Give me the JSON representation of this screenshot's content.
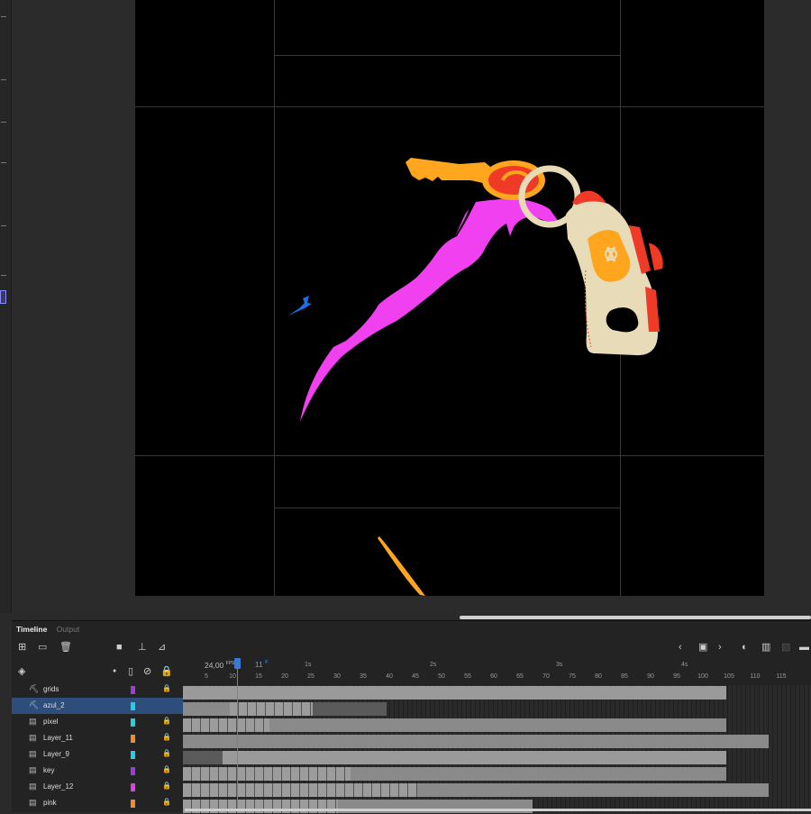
{
  "timeline": {
    "tabs": [
      {
        "label": "Timeline"
      },
      {
        "label": "Output"
      }
    ],
    "fps_value": "24,00",
    "fps_unit": "FPS",
    "current_frame": "11",
    "current_frame_unit": "F",
    "ruler_ticks": [
      "5",
      "10",
      "15",
      "20",
      "25",
      "30",
      "35",
      "40",
      "45",
      "50",
      "55",
      "60",
      "65",
      "70",
      "75",
      "80",
      "85",
      "90",
      "95",
      "100",
      "105",
      "110",
      "115"
    ],
    "ruler_seconds": [
      "1s",
      "2s",
      "3s",
      "4s"
    ],
    "layers": [
      {
        "name": "grids",
        "color": "#9b3ddc",
        "icon": "guide-layer-icon"
      },
      {
        "name": "azul_2",
        "color": "#1ed0e6",
        "icon": "guide-layer-icon",
        "selected": true
      },
      {
        "name": "pixel",
        "color": "#1ed0e6",
        "icon": "normal-layer-icon"
      },
      {
        "name": "Layer_11",
        "color": "#f08a2a",
        "icon": "normal-layer-icon"
      },
      {
        "name": "Layer_9",
        "color": "#1ed0e6",
        "icon": "normal-layer-icon"
      },
      {
        "name": "key",
        "color": "#9b3ddc",
        "icon": "normal-layer-icon"
      },
      {
        "name": "Layer_12",
        "color": "#e040e0",
        "icon": "normal-layer-icon"
      },
      {
        "name": "pink",
        "color": "#f08a2a",
        "icon": "normal-layer-icon"
      }
    ]
  },
  "colors": {
    "stage_background": "#000000",
    "accent_blue": "#3a79d0",
    "key_orange": "#ffa51e",
    "key_red": "#f03a28",
    "keychain_cream": "#e8dcb8",
    "slash_magenta": "#f040f0",
    "bird_blue": "#1a6ee8"
  }
}
